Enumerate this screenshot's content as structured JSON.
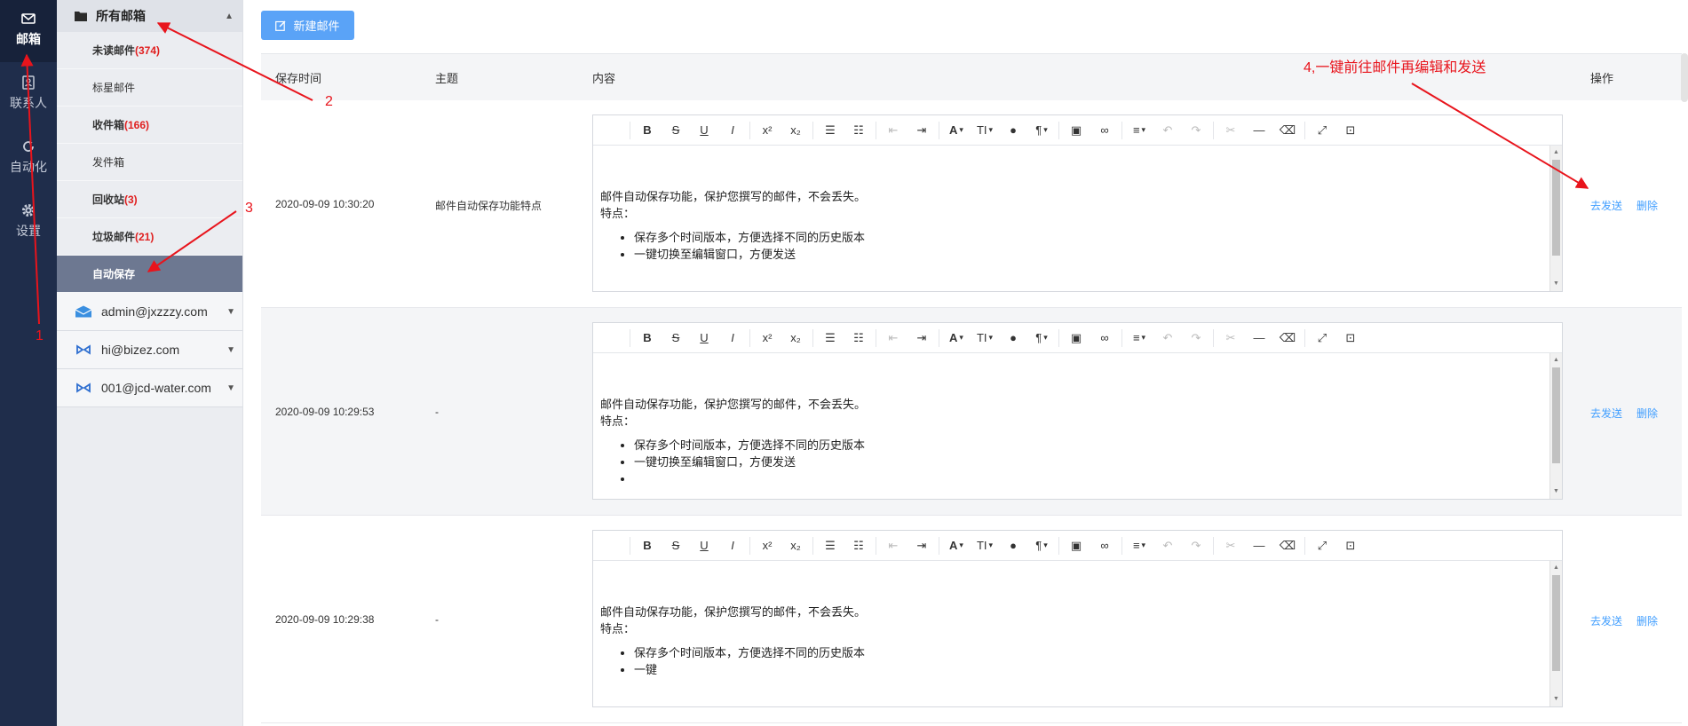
{
  "rail": {
    "items": [
      {
        "label": "邮箱",
        "icon": "mail-icon"
      },
      {
        "label": "联系人",
        "icon": "contact-icon"
      },
      {
        "label": "自动化",
        "icon": "refresh-icon"
      },
      {
        "label": "设置",
        "icon": "gear-icon"
      }
    ]
  },
  "folders": {
    "header": "所有邮箱",
    "items": [
      {
        "label": "未读邮件",
        "count": "(374)"
      },
      {
        "label": "标星邮件",
        "count": ""
      },
      {
        "label": "收件箱",
        "count": "(166)"
      },
      {
        "label": "发件箱",
        "count": ""
      },
      {
        "label": "回收站",
        "count": "(3)"
      },
      {
        "label": "垃圾邮件",
        "count": "(21)"
      },
      {
        "label": "自动保存",
        "count": ""
      }
    ],
    "accounts": [
      {
        "label": "admin@jxzzzy.com"
      },
      {
        "label": "hi@bizez.com"
      },
      {
        "label": "001@jcd-water.com"
      }
    ]
  },
  "main": {
    "new_button": "新建邮件",
    "columns": {
      "time": "保存时间",
      "subject": "主题",
      "content": "内容",
      "ops": "操作"
    },
    "rows": [
      {
        "time": "2020-09-09 10:30:20",
        "subject": "邮件自动保存功能特点",
        "line1": "邮件自动保存功能，保护您撰写的邮件，不会丢失。",
        "line2": "特点：",
        "bullets": [
          "保存多个时间版本，方便选择不同的历史版本",
          "一键切换至编辑窗口，方便发送"
        ],
        "op_send": "去发送",
        "op_delete": "删除"
      },
      {
        "time": "2020-09-09 10:29:53",
        "subject": "-",
        "line1": "邮件自动保存功能，保护您撰写的邮件，不会丢失。",
        "line2": "特点：",
        "bullets": [
          "保存多个时间版本，方便选择不同的历史版本",
          "一键切换至编辑窗口，方便发送",
          ""
        ],
        "op_send": "去发送",
        "op_delete": "删除"
      },
      {
        "time": "2020-09-09 10:29:38",
        "subject": "-",
        "line1": "邮件自动保存功能，保护您撰写的邮件，不会丢失。",
        "line2": "特点：",
        "bullets": [
          "保存多个时间版本，方便选择不同的历史版本",
          "一键"
        ],
        "op_send": "去发送",
        "op_delete": "删除"
      }
    ]
  },
  "annotations": {
    "n1": "1",
    "n2": "2",
    "n3": "3",
    "n4": "4,一键前往邮件再编辑和发送",
    "color": "#e8141c"
  },
  "colors": {
    "rail_bg": "#1f2d4b",
    "folder_bg": "#ebedf1",
    "active_folder": "#6d7891",
    "primary_button": "#5aa3f7",
    "link": "#409eff",
    "count_red": "#e02020"
  }
}
